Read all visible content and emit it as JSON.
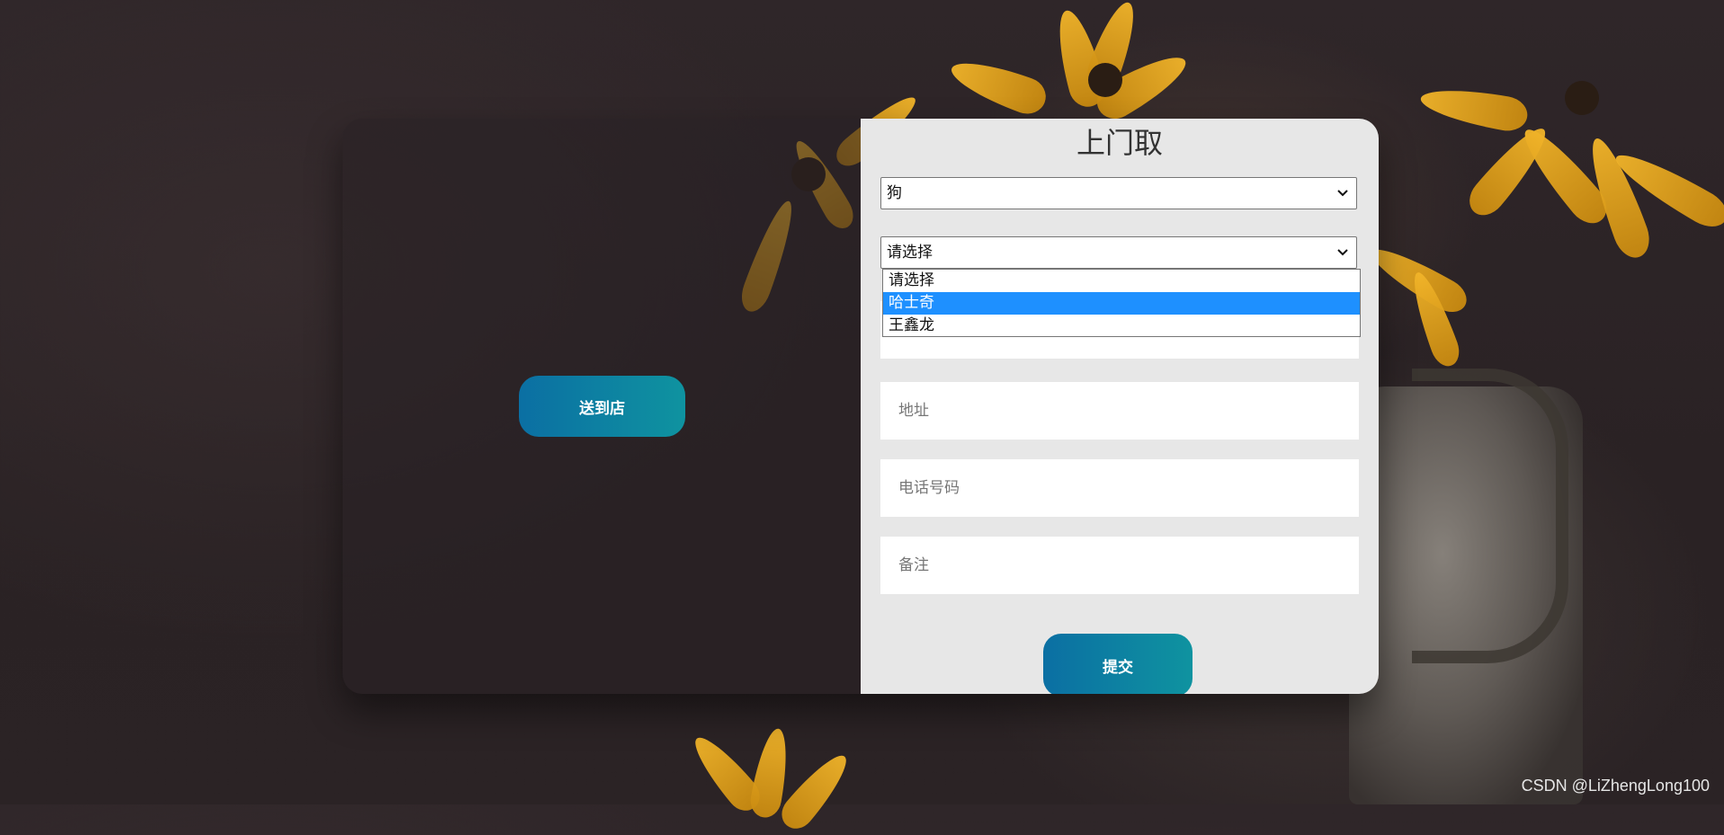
{
  "left_panel": {
    "button_label": "送到店"
  },
  "form": {
    "title": "上门取",
    "pet_type_select": {
      "value": "狗"
    },
    "breed_select": {
      "value": "请选择",
      "options": [
        "请选择",
        "哈士奇",
        "王鑫龙"
      ],
      "highlighted_option": "哈士奇"
    },
    "fields": [
      {
        "placeholder": ""
      },
      {
        "placeholder": "地址"
      },
      {
        "placeholder": "电话号码"
      },
      {
        "placeholder": "备注"
      }
    ],
    "submit_label": "提交"
  },
  "watermark": "CSDN @LiZhengLong100",
  "colors": {
    "button_gradient_start": "#0b6fa3",
    "button_gradient_end": "#0f93a0",
    "dropdown_highlight": "#1e90ff",
    "form_background": "#e7e7e7"
  }
}
